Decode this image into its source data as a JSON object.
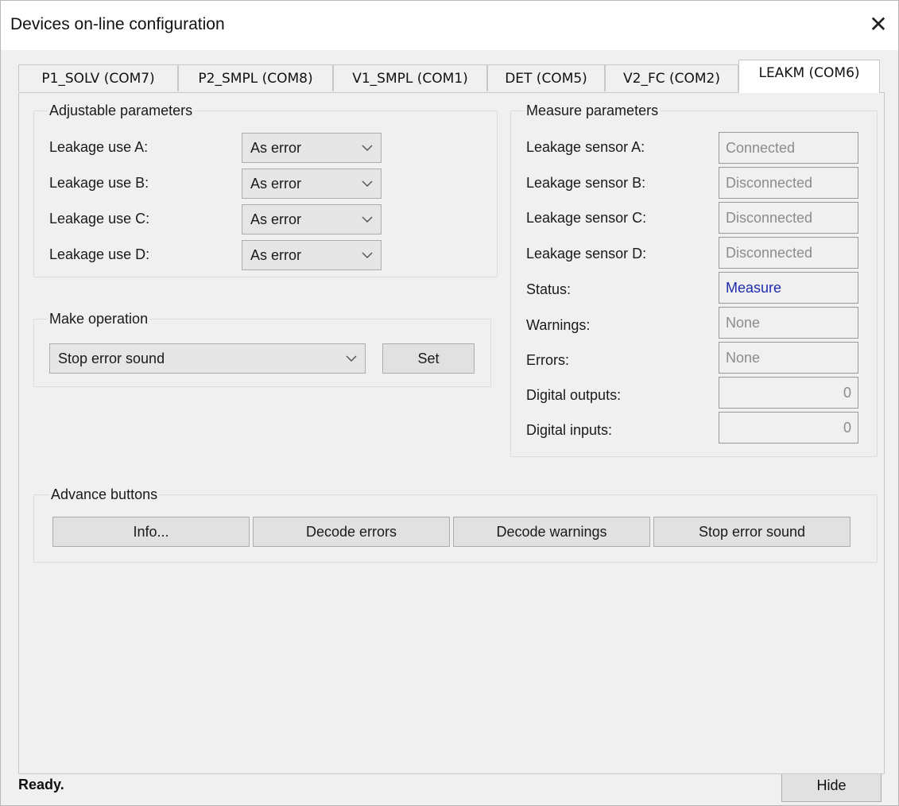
{
  "window": {
    "title": "Devices on-line configuration",
    "close_glyph": "✕"
  },
  "tabs": [
    {
      "label": "P1_SOLV (COM7)",
      "active": false
    },
    {
      "label": "P2_SMPL (COM8)",
      "active": false
    },
    {
      "label": "V1_SMPL (COM1)",
      "active": false
    },
    {
      "label": "DET (COM5)",
      "active": false
    },
    {
      "label": "V2_FC (COM2)",
      "active": false
    },
    {
      "label": "LEAKM (COM6)",
      "active": true
    }
  ],
  "adjustable": {
    "title": "Adjustable parameters",
    "rows": [
      {
        "label": "Leakage use A:",
        "value": "As error"
      },
      {
        "label": "Leakage use B:",
        "value": "As error"
      },
      {
        "label": "Leakage use C:",
        "value": "As error"
      },
      {
        "label": "Leakage use D:",
        "value": "As error"
      }
    ]
  },
  "operation": {
    "title": "Make operation",
    "selected": "Stop error sound",
    "set_label": "Set"
  },
  "measure": {
    "title": "Measure parameters",
    "rows": [
      {
        "label": "Leakage sensor A:",
        "value": "Connected"
      },
      {
        "label": "Leakage sensor B:",
        "value": "Disconnected"
      },
      {
        "label": "Leakage sensor C:",
        "value": "Disconnected"
      },
      {
        "label": "Leakage sensor D:",
        "value": "Disconnected"
      },
      {
        "label": "Status:",
        "value": "Measure"
      },
      {
        "label": "Warnings:",
        "value": "None"
      },
      {
        "label": "Errors:",
        "value": "None"
      },
      {
        "label": "Digital outputs:",
        "value": "0"
      },
      {
        "label": "Digital inputs:",
        "value": "0"
      }
    ]
  },
  "advance": {
    "title": "Advance buttons",
    "buttons": [
      "Info...",
      "Decode errors",
      "Decode warnings",
      "Stop error sound"
    ]
  },
  "statusbar": {
    "text": "Ready.",
    "hide_label": "Hide"
  },
  "colors": {
    "status_value": "#1f2bb0",
    "disabled_text": "#8c8c8c",
    "window_bg": "#f0f0f0"
  }
}
